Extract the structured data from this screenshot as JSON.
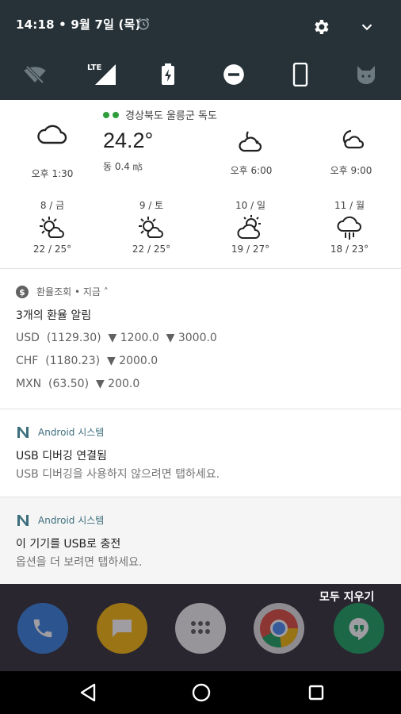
{
  "status": {
    "datetime": "14:18 • 9월 7일 (목)"
  },
  "icons": {
    "alarm": "alarm-icon",
    "settings": "gear-icon",
    "expand": "chevron-down-icon",
    "tiles": [
      "wifi-off-icon",
      "lte-signal-icon",
      "battery-charging-icon",
      "do-not-disturb-icon",
      "phone-rotate-icon",
      "cat-icon"
    ]
  },
  "weather": {
    "location": "경상북도 울릉군 독도",
    "current": {
      "temp": "24.2°",
      "wind": "동 0.4 ㎧",
      "time": "오후 1:30",
      "icon": "cloudy-icon"
    },
    "hourly": [
      {
        "time": "오후 6:00",
        "icon": "partly-cloudy-night-icon"
      },
      {
        "time": "오후 9:00",
        "icon": "moon-cloud-icon"
      }
    ],
    "daily": [
      {
        "day": "8 / 금",
        "range": "22 / 25°",
        "icon": "sun-cloud-icon"
      },
      {
        "day": "9 / 토",
        "range": "22 / 25°",
        "icon": "sun-cloud-icon"
      },
      {
        "day": "10 / 일",
        "range": "19 / 27°",
        "icon": "sun-behind-cloud-icon"
      },
      {
        "day": "11 / 월",
        "range": "18 / 23°",
        "icon": "rain-cloud-icon"
      }
    ]
  },
  "notifications": {
    "exchange": {
      "app_line": "환율조회 • 지금 ˄",
      "title": "3개의 환율 알림",
      "rates": [
        "USD  (1129.30)  ▼ 1200.0  ▼ 3000.0",
        "CHF  (1180.23)  ▼ 2000.0",
        "MXN  (63.50)  ▼ 200.0"
      ]
    },
    "usb_debug": {
      "app_line": "Android 시스템",
      "title": "USB 디버깅 연결됨",
      "text": "USB 디버깅을 사용하지 않으려면 탭하세요."
    },
    "usb_charge": {
      "app_line": "Android 시스템",
      "title": "이 기기를 USB로 충전",
      "text": "옵션을 더 보려면 탭하세요."
    }
  },
  "actions": {
    "clear_all": "모두 지우기"
  },
  "colors": {
    "header": "#263238",
    "android_n": "#3c6e7c",
    "green_dot": "#2e9d3a"
  }
}
